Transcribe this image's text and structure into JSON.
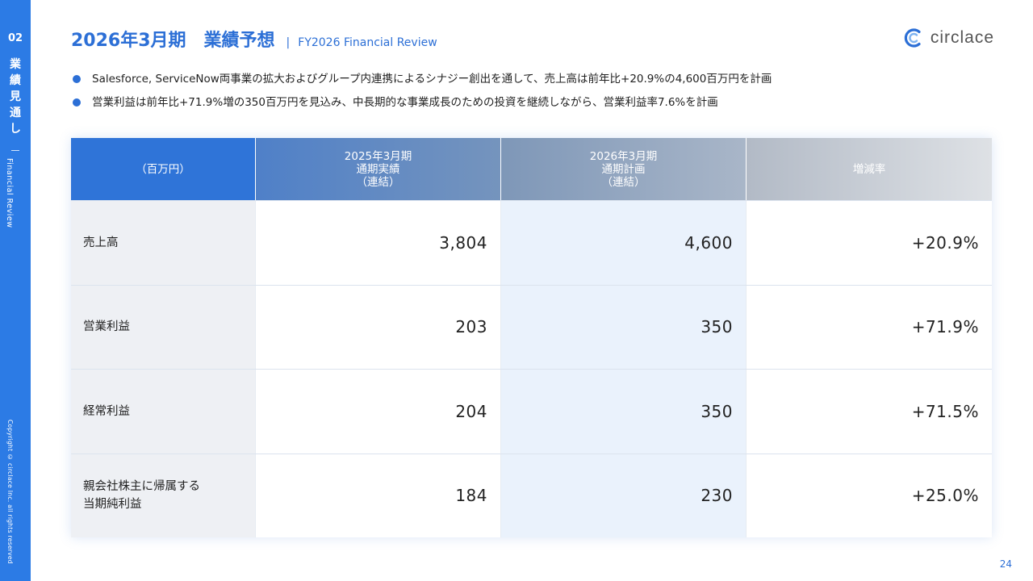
{
  "sidebar": {
    "number": "02",
    "title_chars": [
      "業",
      "績",
      "見",
      "通",
      "し"
    ],
    "subtitle": "Financial Review",
    "copyright": "Copyright © circlace Inc. all rights reserved"
  },
  "header": {
    "title": "2026年3月期　業績予想",
    "separator": "|",
    "subtitle": "FY2026 Financial Review"
  },
  "logo": {
    "text": "circlace"
  },
  "bullets": [
    "Salesforce, ServiceNow両事業の拡大およびグループ内連携によるシナジー創出を通して、売上高は前年比+20.9%の4,600百万円を計画",
    "営業利益は前年比+71.9%増の350百万円を見込み、中長期的な事業成長のための投資を継続しながら、営業利益率7.6%を計画"
  ],
  "table": {
    "headers": {
      "label": "（百万円）",
      "prev": [
        "2025年3月期",
        "通期実績",
        "（連結）"
      ],
      "plan": [
        "2026年3月期",
        "通期計画",
        "（連結）"
      ],
      "rate": "増減率"
    },
    "rows": [
      {
        "label": [
          "売上高"
        ],
        "prev": "3,804",
        "plan": "4,600",
        "rate": "+20.9%"
      },
      {
        "label": [
          "営業利益"
        ],
        "prev": "203",
        "plan": "350",
        "rate": "+71.9%"
      },
      {
        "label": [
          "経常利益"
        ],
        "prev": "204",
        "plan": "350",
        "rate": "+71.5%"
      },
      {
        "label": [
          "親会社株主に帰属する",
          "当期純利益"
        ],
        "prev": "184",
        "plan": "230",
        "rate": "+25.0%"
      }
    ]
  },
  "page_number": "24",
  "colors": {
    "accent": "#2c6fd6",
    "sidebar": "#2c7be5"
  }
}
